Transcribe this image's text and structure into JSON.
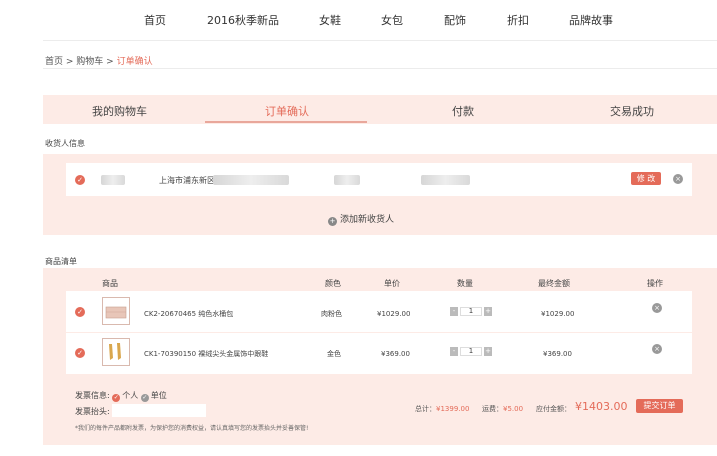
{
  "nav": {
    "items": [
      "首页",
      "2016秋季新品",
      "女鞋",
      "女包",
      "配饰",
      "折扣",
      "品牌故事"
    ]
  },
  "breadcrumb": {
    "home": "首页",
    "sep1": " > ",
    "cart": "购物车",
    "sep2": " > ",
    "current": "订单确认"
  },
  "steps": {
    "items": [
      "我的购物车",
      "订单确认",
      "付款",
      "交易成功"
    ],
    "active": 1
  },
  "consignee": {
    "section_title": "收货人信息",
    "address_visible": "上海市浦东新区",
    "edit_label": "修 改",
    "add_label": "添加新收货人"
  },
  "goods": {
    "section_title": "商品清单",
    "headers": {
      "product": "商品",
      "color": "颜色",
      "price": "单价",
      "qty": "数量",
      "total": "最终金额",
      "op": "操作"
    },
    "rows": [
      {
        "name": "CK2-20670465 纯色水桶包",
        "color": "肉粉色",
        "price": "¥1029.00",
        "qty": "1",
        "total": "¥1029.00"
      },
      {
        "name": "CK1-70390150 裸绒尖头金属饰中跟鞋",
        "color": "金色",
        "price": "¥369.00",
        "qty": "1",
        "total": "¥369.00"
      }
    ],
    "qty_minus": "-",
    "qty_plus": "+"
  },
  "invoice": {
    "label": "发票信息:",
    "opt_personal": "个人",
    "opt_company": "单位",
    "title_label": "发票抬头:",
    "title_value": "",
    "note": "*我们的每件产品都附发票，为保护您的消费权益，请认真填写您的发票抬头并妥善保管!"
  },
  "summary": {
    "total_label": "总计：",
    "total_value": "¥1399.00",
    "shipping_label": "运费：",
    "shipping_value": "¥5.00",
    "payable_label": "应付金额：",
    "payable_value": "¥1403.00",
    "submit_label": "提交订单"
  },
  "colors": {
    "accent": "#e46b59",
    "panel": "#fdebe6"
  }
}
